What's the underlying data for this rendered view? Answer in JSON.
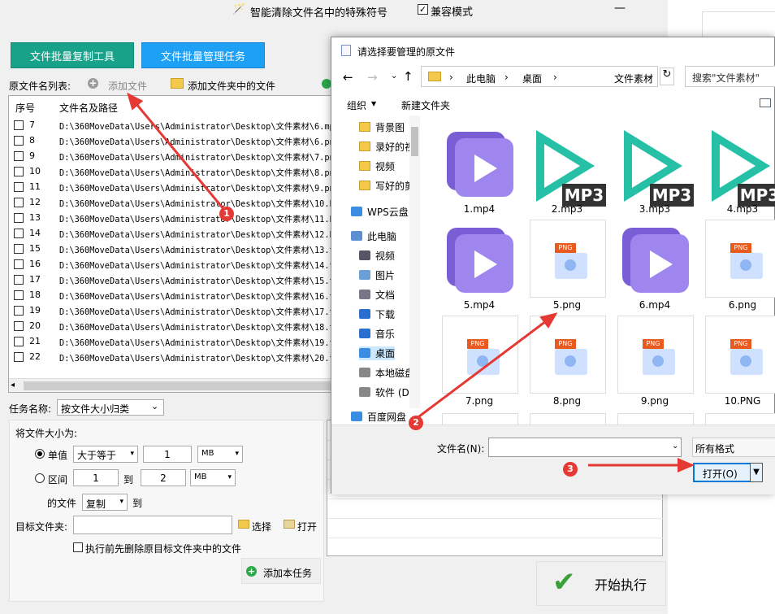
{
  "window": {
    "title": "智能清除文件名中的特殊符号",
    "compat_label": "兼容模式",
    "min": "—",
    "max": "☐",
    "close": "✕"
  },
  "tabs": {
    "copy_tool": "文件批量复制工具",
    "manage_task": "文件批量管理任务"
  },
  "toolbar": {
    "list_label": "原文件名列表:",
    "add_file": "添加文件",
    "add_folder": "添加文件夹中的文件"
  },
  "filelist": {
    "col_seq": "序号",
    "col_path": "文件名及路径",
    "rows": [
      {
        "seq": "7",
        "path": "D:\\360MoveData\\Users\\Administrator\\Desktop\\文件素材\\6.mp"
      },
      {
        "seq": "8",
        "path": "D:\\360MoveData\\Users\\Administrator\\Desktop\\文件素材\\6.pn"
      },
      {
        "seq": "9",
        "path": "D:\\360MoveData\\Users\\Administrator\\Desktop\\文件素材\\7.pn"
      },
      {
        "seq": "10",
        "path": "D:\\360MoveData\\Users\\Administrator\\Desktop\\文件素材\\8.pn"
      },
      {
        "seq": "11",
        "path": "D:\\360MoveData\\Users\\Administrator\\Desktop\\文件素材\\9.pn"
      },
      {
        "seq": "12",
        "path": "D:\\360MoveData\\Users\\Administrator\\Desktop\\文件素材\\10.P"
      },
      {
        "seq": "13",
        "path": "D:\\360MoveData\\Users\\Administrator\\Desktop\\文件素材\\11.P"
      },
      {
        "seq": "14",
        "path": "D:\\360MoveData\\Users\\Administrator\\Desktop\\文件素材\\12.P"
      },
      {
        "seq": "15",
        "path": "D:\\360MoveData\\Users\\Administrator\\Desktop\\文件素材\\13.t"
      },
      {
        "seq": "16",
        "path": "D:\\360MoveData\\Users\\Administrator\\Desktop\\文件素材\\14.t"
      },
      {
        "seq": "17",
        "path": "D:\\360MoveData\\Users\\Administrator\\Desktop\\文件素材\\15.t"
      },
      {
        "seq": "18",
        "path": "D:\\360MoveData\\Users\\Administrator\\Desktop\\文件素材\\16.t"
      },
      {
        "seq": "19",
        "path": "D:\\360MoveData\\Users\\Administrator\\Desktop\\文件素材\\17.t"
      },
      {
        "seq": "20",
        "path": "D:\\360MoveData\\Users\\Administrator\\Desktop\\文件素材\\18.t"
      },
      {
        "seq": "21",
        "path": "D:\\360MoveData\\Users\\Administrator\\Desktop\\文件素材\\19.t"
      },
      {
        "seq": "22",
        "path": "D:\\360MoveData\\Users\\Administrator\\Desktop\\文件素材\\20.t"
      }
    ]
  },
  "task": {
    "name_label": "任务名称:",
    "name_value": "按文件大小归类",
    "size_label": "将文件大小为:",
    "single_label": "单值",
    "cmp_value": "大于等于",
    "size_value": "1",
    "unit_value": "MB",
    "range_label": "区间",
    "range_min": "1",
    "to": "到",
    "range_max": "2",
    "range_unit": "MB",
    "file_of": "的文件",
    "action_value": "复制",
    "target_label": "目标文件夹:",
    "select_btn": "选择",
    "open_btn": "打开",
    "delete_label": "执行前先删除原目标文件夹中的文件",
    "add_task": "添加本任务",
    "start": "开始执行"
  },
  "dialog": {
    "title": "请选择要管理的原文件",
    "crumbs": [
      "›",
      "此电脑",
      "›",
      "桌面",
      "›",
      "文件素材"
    ],
    "search_placeholder": "搜索\"文件素材\"",
    "organize": "组织",
    "new_folder": "新建文件夹",
    "tree": [
      {
        "label": "背景图",
        "type": "folder"
      },
      {
        "label": "录好的视",
        "type": "folder"
      },
      {
        "label": "视频",
        "type": "folder"
      },
      {
        "label": "写好的剪",
        "type": "folder"
      },
      {
        "label": "WPS云盘",
        "type": "cloud"
      },
      {
        "label": "此电脑",
        "type": "pc"
      },
      {
        "label": "视频",
        "type": "video"
      },
      {
        "label": "图片",
        "type": "image"
      },
      {
        "label": "文档",
        "type": "doc"
      },
      {
        "label": "下载",
        "type": "download"
      },
      {
        "label": "音乐",
        "type": "music"
      },
      {
        "label": "桌面",
        "type": "desktop"
      },
      {
        "label": "本地磁盘",
        "type": "disk"
      },
      {
        "label": "软件 (D",
        "type": "disk"
      },
      {
        "label": "百度网盘",
        "type": "cloud"
      }
    ],
    "files": [
      {
        "name": "1.mp4",
        "kind": "mp4"
      },
      {
        "name": "2.mp3",
        "kind": "mp3"
      },
      {
        "name": "3.mp3",
        "kind": "mp3"
      },
      {
        "name": "4.mp3",
        "kind": "mp3"
      },
      {
        "name": "5.mp4",
        "kind": "mp4"
      },
      {
        "name": "5.png",
        "kind": "png"
      },
      {
        "name": "6.mp4",
        "kind": "mp4"
      },
      {
        "name": "6.png",
        "kind": "png"
      },
      {
        "name": "7.png",
        "kind": "png"
      },
      {
        "name": "8.png",
        "kind": "png"
      },
      {
        "name": "9.png",
        "kind": "png"
      },
      {
        "name": "10.PNG",
        "kind": "png"
      }
    ],
    "mp3_tag": "MP3",
    "png_tag": "PNG",
    "filename_label": "文件名(N):",
    "filter": "所有格式",
    "open_button": "打开(O)"
  },
  "markers": [
    "1",
    "2",
    "3"
  ],
  "colors": {
    "copy_tab": "#19a28a",
    "manage_tab": "#1ea0f5",
    "marker": "#e53935",
    "mp4": "#9e86ee",
    "mp3": "#25c0a6"
  }
}
